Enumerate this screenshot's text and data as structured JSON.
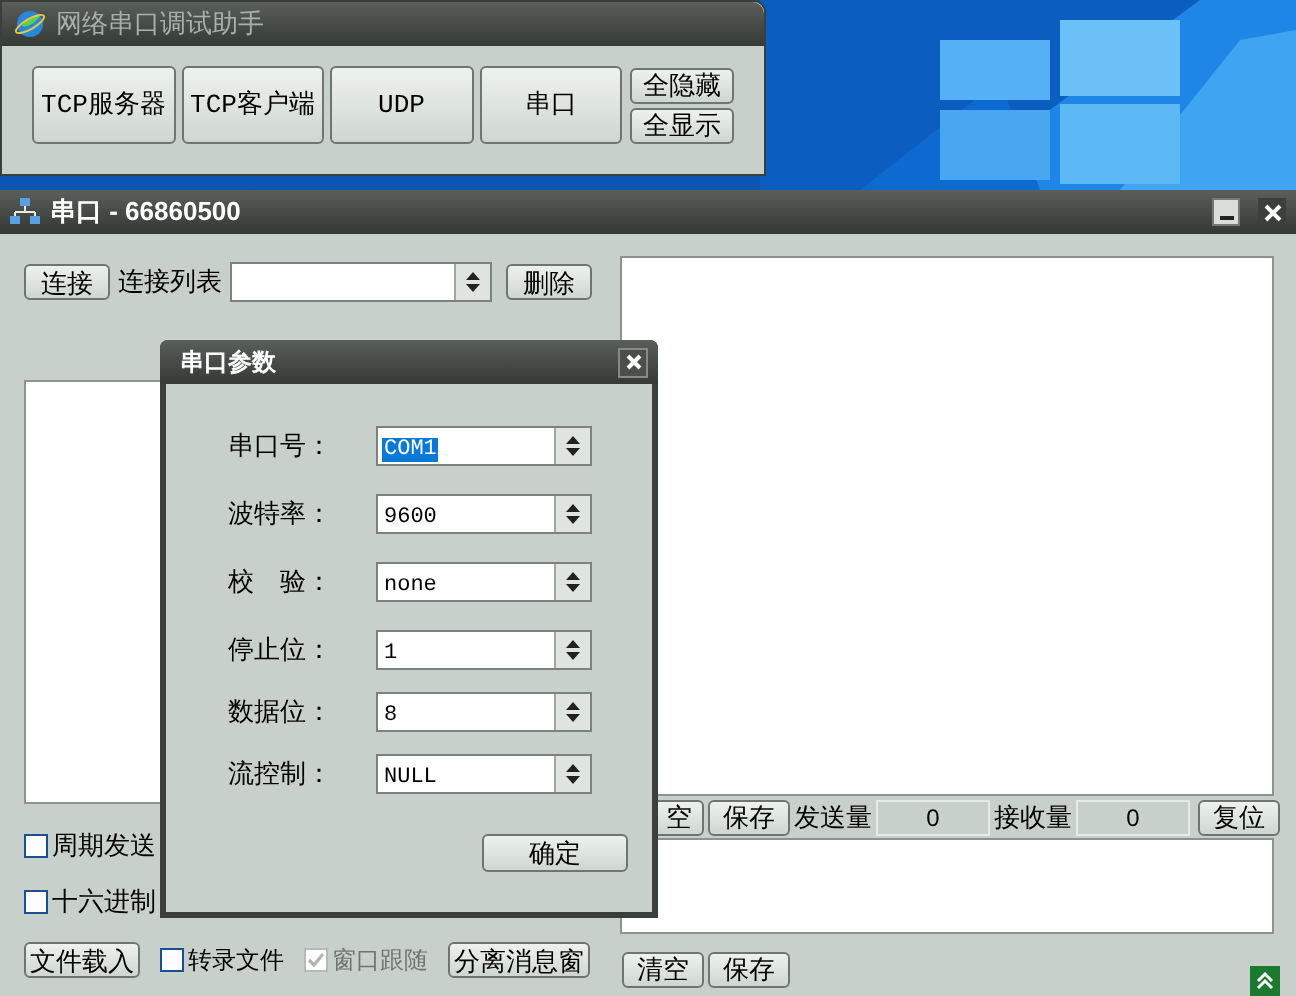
{
  "app_window": {
    "title": "网络串口调试助手",
    "mode_buttons": [
      "TCP服务器",
      "TCP客户端",
      "UDP",
      "串口"
    ],
    "side_buttons": [
      "全隐藏",
      "全显示"
    ]
  },
  "serial_window": {
    "title": "串口 - 66860500"
  },
  "connection": {
    "connect_button": "连接",
    "list_label": "连接列表",
    "delete_button": "删除"
  },
  "options": [
    {
      "label": "周期发送",
      "checked": false
    },
    {
      "label": "十六进制",
      "checked": false
    }
  ],
  "bottom_bar": [
    {
      "kind": "button",
      "label": "文件载入"
    },
    {
      "kind": "checkbox",
      "label": "转录文件",
      "checked": false,
      "disabled": false
    },
    {
      "kind": "checkbox",
      "label": "窗口跟随",
      "checked": true,
      "disabled": true
    },
    {
      "kind": "button",
      "label": "分离消息窗"
    }
  ],
  "receive_bar": {
    "clear": "空",
    "save": "保存",
    "sent_label": "发送量",
    "sent_count": "0",
    "received_label": "接收量",
    "received_count": "0",
    "reset": "复位"
  },
  "send_bar": [
    "清空",
    "保存"
  ],
  "dialog": {
    "title": "串口参数",
    "fields": [
      {
        "label": "串口号：",
        "value": "COM1",
        "selected": true
      },
      {
        "label": "波特率：",
        "value": "9600",
        "selected": false
      },
      {
        "label": "校　验：",
        "value": "none",
        "selected": false
      },
      {
        "label": "停止位：",
        "value": "1",
        "selected": false
      },
      {
        "label": "数据位：",
        "value": "8",
        "selected": false
      },
      {
        "label": "流控制：",
        "value": "NULL",
        "selected": false
      }
    ],
    "ok": "确定"
  }
}
